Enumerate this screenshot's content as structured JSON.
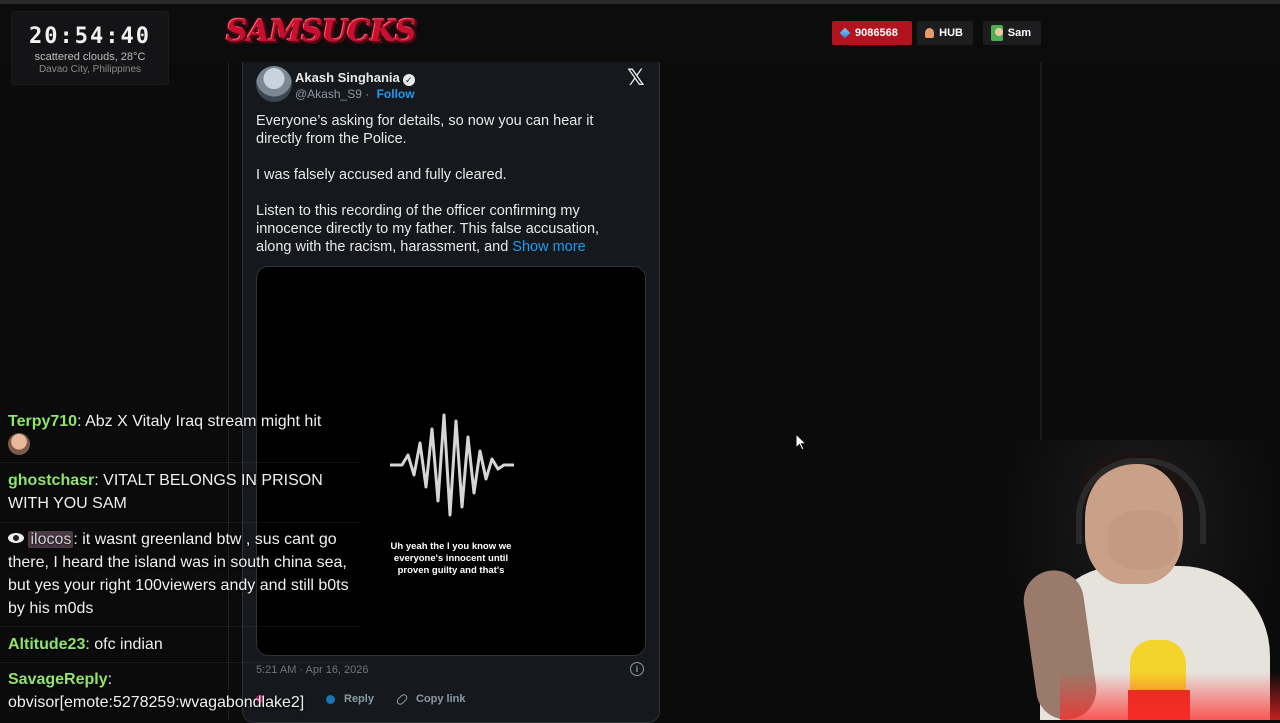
{
  "overlay": {
    "clock": {
      "time": "20:54:40",
      "weather": "scattered clouds, 28°C",
      "location": "Davao City, Philippines"
    },
    "logo": {
      "text": "SAMSUCKS"
    },
    "header": {
      "gems": "9086568",
      "hub_label": "HUB",
      "user_label": "Sam"
    }
  },
  "tweet": {
    "author_name": "Akash Singhania",
    "handle": "@Akash_S9",
    "follow_label": "Follow",
    "paragraphs": [
      "Everyone’s asking for details, so now you can hear it directly from the Police.",
      "I was falsely accused and fully cleared.",
      "Listen to this recording of the officer confirming my innocence directly to my father. This false accusation, along with the racism, harassment, and"
    ],
    "show_more_label": "Show more",
    "media_caption": "Uh yeah the I you know we everyone's innocent until proven guilty and that's",
    "timestamp": "5:21 AM · Apr 16, 2026",
    "reply_label": "Reply",
    "copy_link_label": "Copy link"
  },
  "chat": {
    "messages": [
      {
        "user": "Terpy710",
        "text": ": Abz X Vitaly Iraq stream might hit"
      },
      {
        "user": "ghostchasr",
        "text": ": VITALT BELONGS IN PRISON WITH YOU SAM"
      },
      {
        "user": "ilocos",
        "text": ": it wasnt greenland btw , sus cant go there, I heard the island was in south china sea, but yes your right 100viewers andy and still b0ts by his m0ds"
      },
      {
        "user": "Altitude23",
        "text": ": ofc indian"
      },
      {
        "user": "SavageReply",
        "text": ":"
      },
      {
        "user": "",
        "text": "obvisor[emote:5278259:wvagabondlake2]"
      }
    ]
  },
  "colors": {
    "accent_red": "#b3131f",
    "link_blue": "#1d9bf0",
    "chat_user_green": "#8ee66a"
  }
}
